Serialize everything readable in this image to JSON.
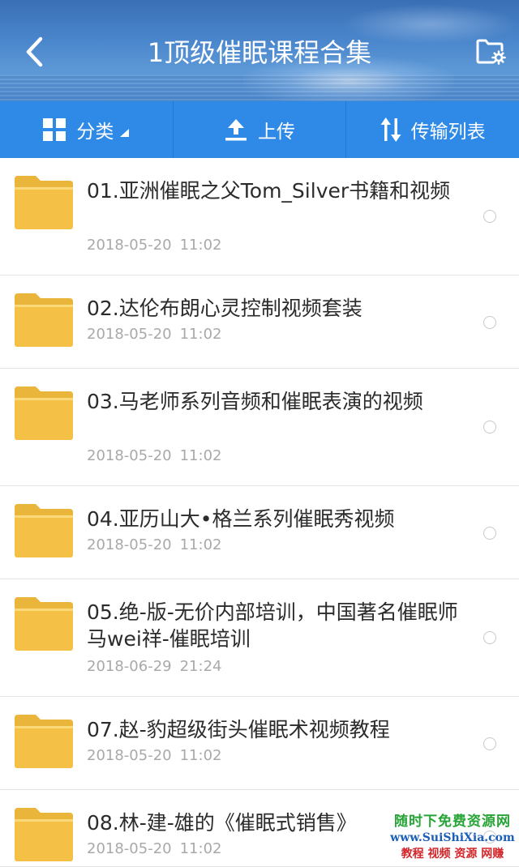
{
  "header": {
    "title": "1顶级催眠课程合集",
    "back_icon": "chevron-left-icon",
    "folder_settings_icon": "folder-gear-icon"
  },
  "toolbar": {
    "category_label": "分类",
    "upload_label": "上传",
    "transfer_label": "传输列表"
  },
  "files": [
    {
      "name": "01.亚洲催眠之父Tom_Silver书籍和视频",
      "date": "2018-05-20",
      "time": "11:02"
    },
    {
      "name": "02.达伦布朗心灵控制视频套装",
      "date": "2018-05-20",
      "time": "11:02"
    },
    {
      "name": "03.马老师系列音频和催眠表演的视频",
      "date": "2018-05-20",
      "time": "11:02"
    },
    {
      "name": "04.亚历山大•格兰系列催眠秀视频",
      "date": "2018-05-20",
      "time": "11:02"
    },
    {
      "name": "05.绝-版-无价内部培训，中国著名催眠师马wei祥-催眠培训",
      "date": "2018-06-29",
      "time": "21:24"
    },
    {
      "name": "07.赵-豹超级街头催眠术视频教程",
      "date": "2018-05-20",
      "time": "11:02"
    },
    {
      "name": "08.林-建-雄的《催眠式销售》",
      "date": "2018-05-20",
      "time": "11:02"
    }
  ],
  "watermark": {
    "line1": "随时下免费资源网",
    "line2": "www.SuiShiXia.com",
    "line3": "教程 视频 资源 网赚"
  },
  "colors": {
    "toolbar_bg": "#2e8ae6",
    "folder": "#f5c046",
    "text_primary": "#2b2b2b",
    "text_secondary": "#a9a9a9"
  }
}
